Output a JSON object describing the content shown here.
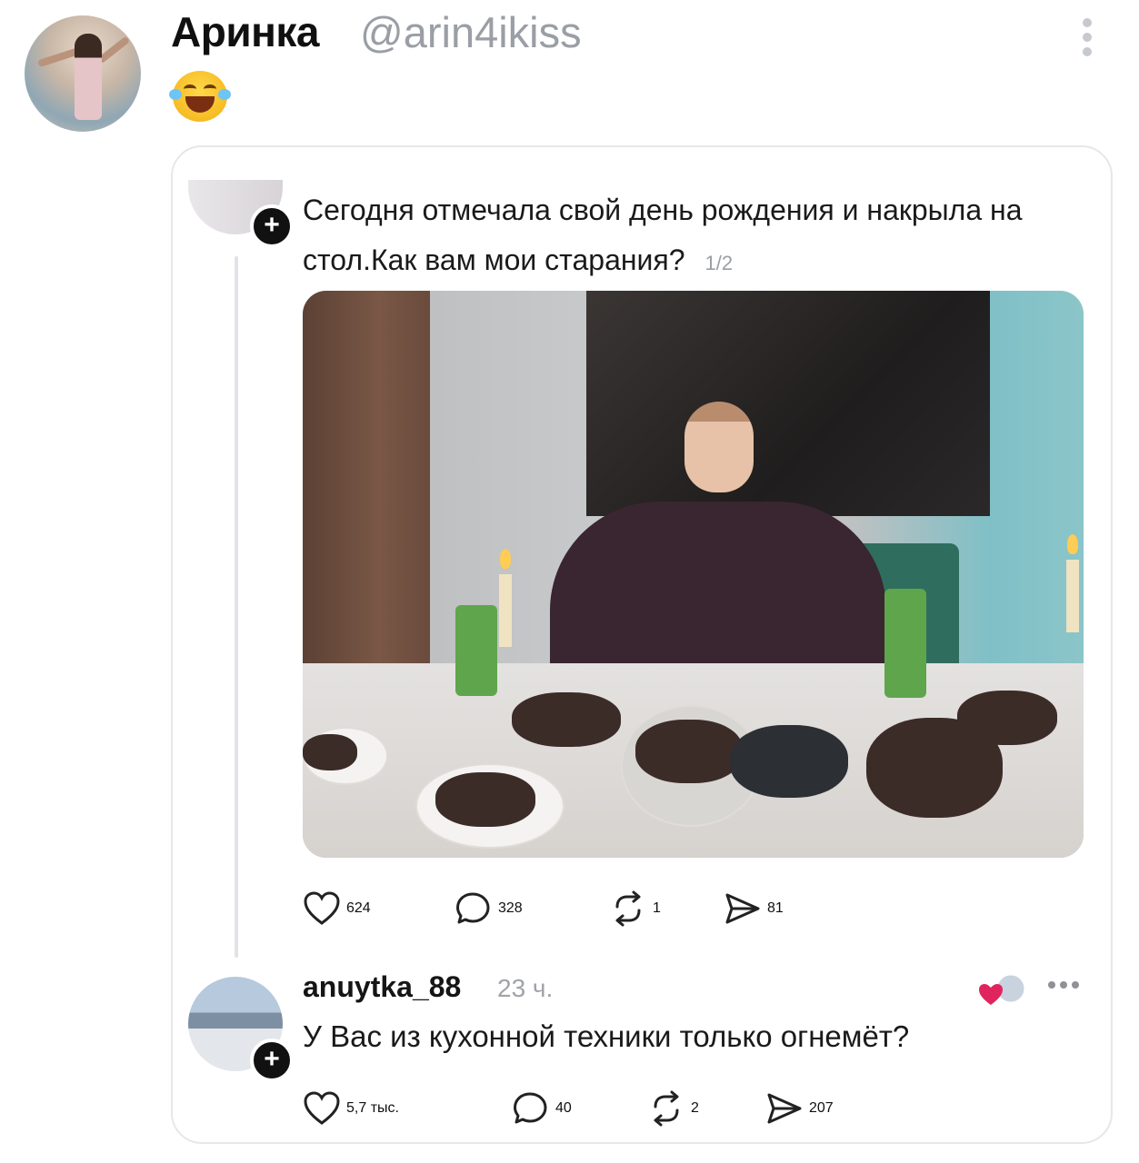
{
  "author": {
    "name": "Аринка",
    "handle": "@arin4ikiss",
    "reaction_emoji": "face-with-tears-of-joy"
  },
  "quoted_post": {
    "text": "Сегодня отмечала свой день рождения и накрыла на стол.Как вам мои старания?",
    "pager": "1/2",
    "photo": "birthday-dinner-table-photo",
    "stats": {
      "likes": "624",
      "replies": "328",
      "reposts": "1",
      "shares": "81"
    }
  },
  "comment": {
    "username": "anuytka_88",
    "time": "23 ч.",
    "text": "У Вас из кухонной техники только огнемёт?",
    "stats": {
      "likes": "5,7 тыс.",
      "replies": "40",
      "reposts": "2",
      "shares": "207"
    }
  },
  "colors": {
    "handle": "#9a9ea5",
    "card_border": "#e6e7ea",
    "heart_liked": "#e0245e"
  }
}
